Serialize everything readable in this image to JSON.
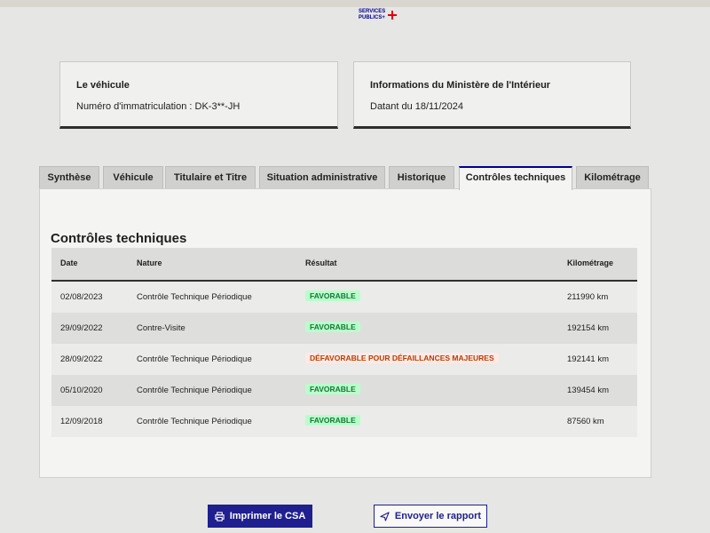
{
  "header": {
    "logo_line1": "SERVICES",
    "logo_line2": "PUBLICS+"
  },
  "vehicle_box": {
    "title": "Le véhicule",
    "plate_text": "Numéro d'immatriculation : DK-3**-JH"
  },
  "ministry_box": {
    "title": "Informations du Ministère de l'Intérieur",
    "date_text": "Datant du 18/11/2024"
  },
  "tabs": [
    {
      "label": "Synthèse"
    },
    {
      "label": "Véhicule"
    },
    {
      "label": "Titulaire et Titre"
    },
    {
      "label": "Situation administrative"
    },
    {
      "label": "Historique"
    },
    {
      "label": "Contrôles techniques"
    },
    {
      "label": "Kilométrage"
    }
  ],
  "active_tab": "Contrôles techniques",
  "section": {
    "title": "Contrôles techniques"
  },
  "table": {
    "headers": {
      "date": "Date",
      "nature": "Nature",
      "result": "Résultat",
      "mileage": "Kilométrage"
    },
    "rows": [
      {
        "date": "02/08/2023",
        "nature": "Contrôle Technique Périodique",
        "result": "FAVORABLE",
        "mileage": "211990 km"
      },
      {
        "date": "29/09/2022",
        "nature": "Contre-Visite",
        "result": "FAVORABLE",
        "mileage": "192154 km"
      },
      {
        "date": "28/09/2022",
        "nature": "Contrôle Technique Périodique",
        "result": "DÉFAVORABLE POUR DÉFAILLANCES MAJEURES",
        "mileage": "192141 km"
      },
      {
        "date": "05/10/2020",
        "nature": "Contrôle Technique Périodique",
        "result": "FAVORABLE",
        "mileage": "139454 km"
      },
      {
        "date": "12/09/2018",
        "nature": "Contrôle Technique Périodique",
        "result": "FAVORABLE",
        "mileage": "87560 km"
      }
    ]
  },
  "buttons": {
    "print": "Imprimer le CSA",
    "send": "Envoyer le rapport"
  },
  "colors": {
    "primary": "#000091",
    "favorable_bg": "#b8fec9",
    "favorable_text": "#18753c",
    "unfavorable_bg": "#ffe9e6",
    "unfavorable_text": "#b34000"
  },
  "icons": {
    "print": "printer-icon",
    "send": "send-icon"
  }
}
